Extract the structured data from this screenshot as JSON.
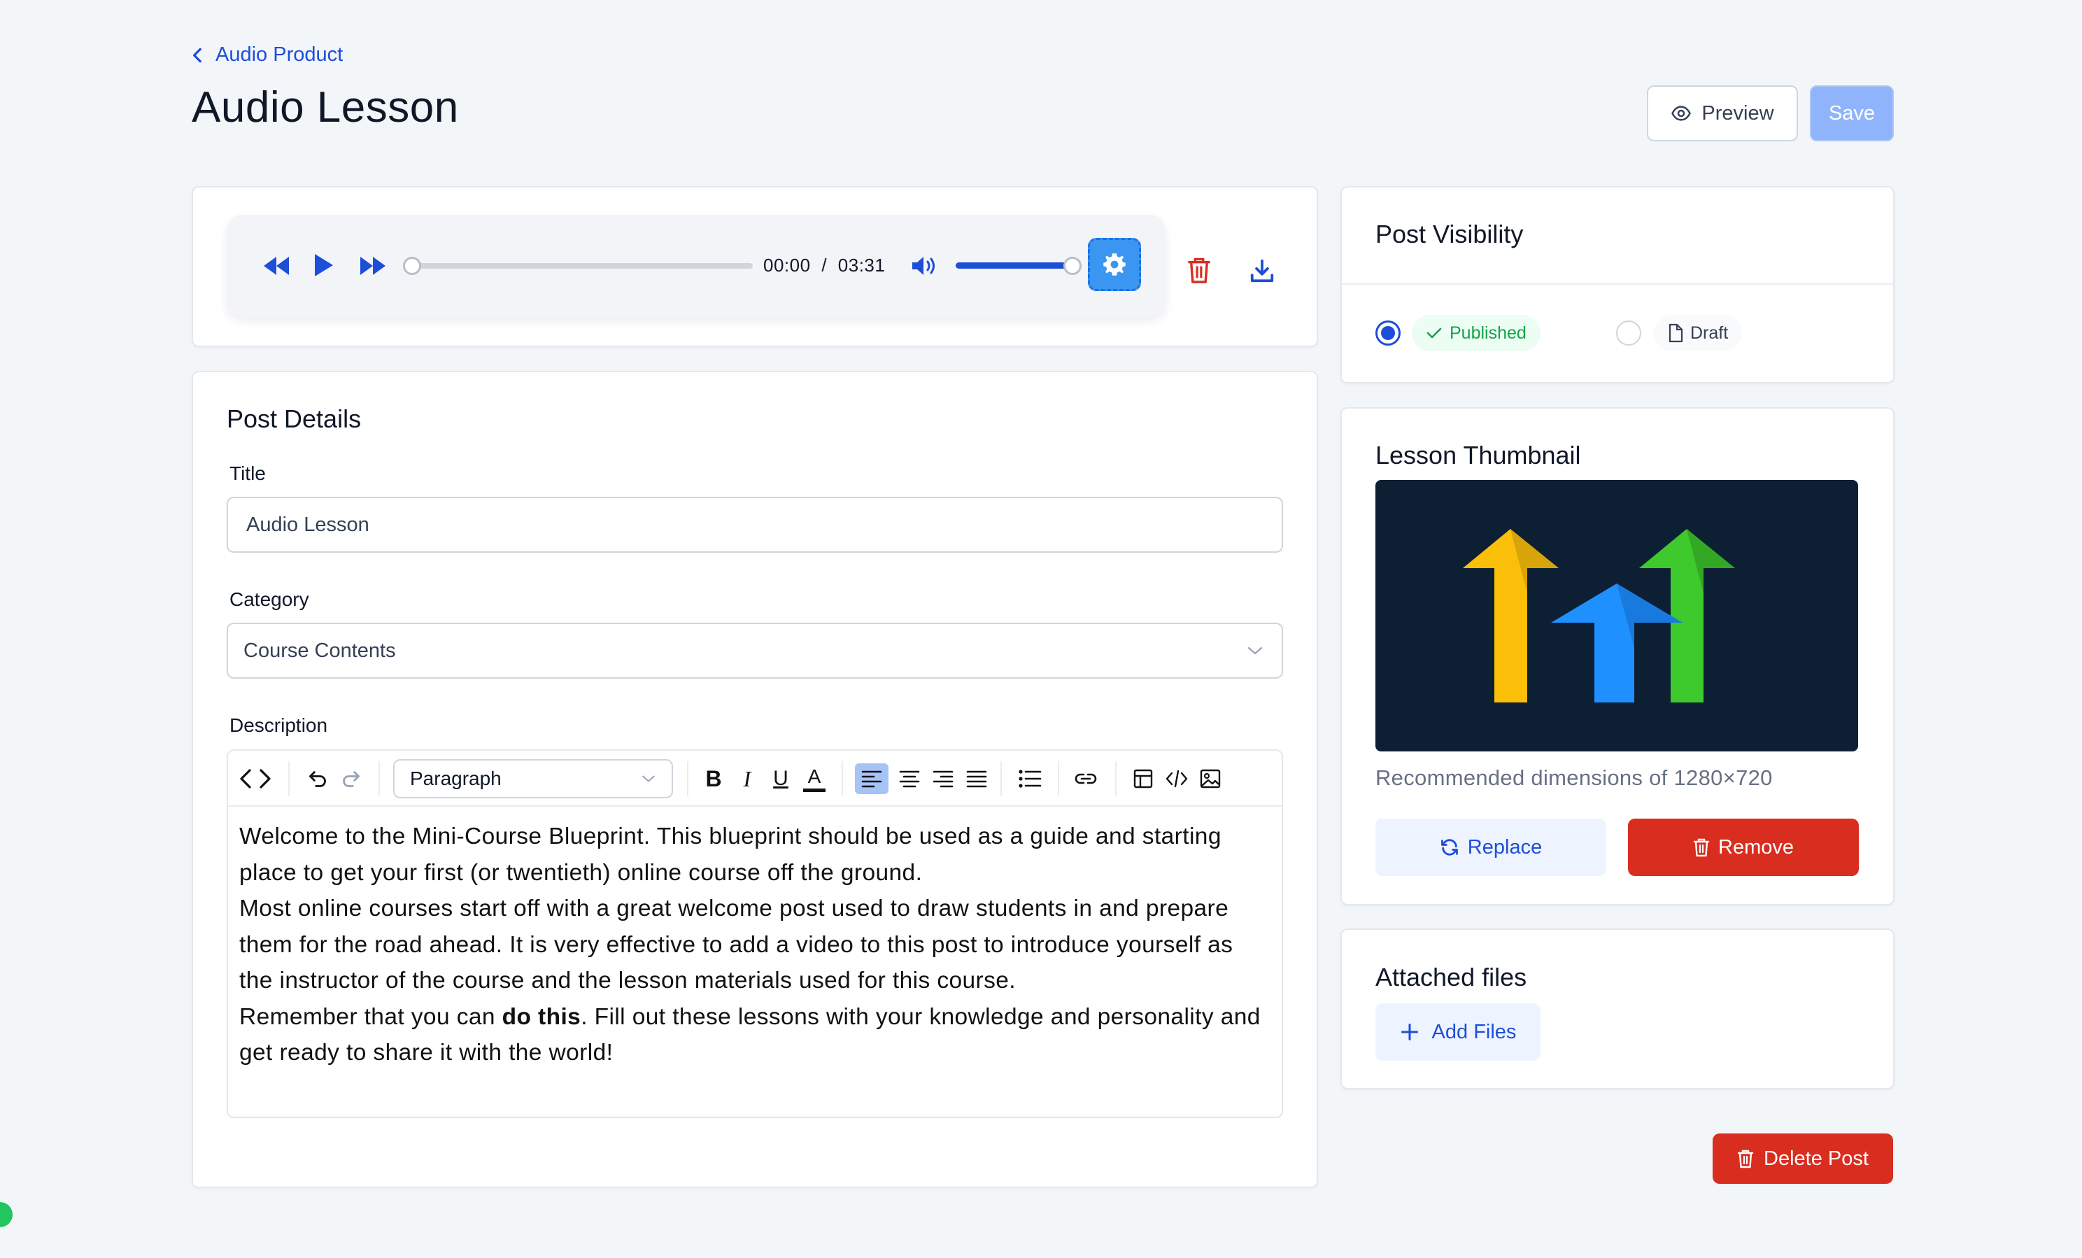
{
  "header": {
    "breadcrumb": "Audio Product",
    "title": "Audio Lesson",
    "preview_label": "Preview",
    "save_label": "Save"
  },
  "audio_player": {
    "current_time": "00:00",
    "separator": "/",
    "duration": "03:31",
    "progress": 0,
    "volume": 1.0
  },
  "post_details": {
    "section_title": "Post Details",
    "title_label": "Title",
    "title_value": "Audio Lesson",
    "category_label": "Category",
    "category_value": "Course Contents",
    "description_label": "Description",
    "editor": {
      "block_format": "Paragraph",
      "active_alignment": "left",
      "paragraphs": {
        "p1": "Welcome to the Mini-Course Blueprint. This blueprint should be used as a guide and starting place to get your first (or twentieth) online course off the ground.",
        "p2": "Most online courses start off with a great welcome post used to draw students in and prepare them for the road ahead. It is very effective to add a video to this post to introduce yourself as the instructor of the course and the lesson materials used for this course.",
        "p3_before": "Remember that you can ",
        "p3_bold": "do this",
        "p3_after": ". Fill out these lessons with your knowledge and personality and get ready to share it with the world!"
      }
    }
  },
  "visibility": {
    "title": "Post Visibility",
    "options": [
      {
        "label": "Published",
        "selected": true
      },
      {
        "label": "Draft",
        "selected": false
      }
    ]
  },
  "thumbnail": {
    "title": "Lesson Thumbnail",
    "hint": "Recommended dimensions of 1280×720",
    "replace_label": "Replace",
    "remove_label": "Remove"
  },
  "attachments": {
    "title": "Attached files",
    "add_label": "Add Files"
  },
  "delete_label": "Delete Post",
  "colors": {
    "accent": "#1d4ed8",
    "danger": "#d92d20",
    "success": "#16a34a",
    "page_bg": "#f3f6f9"
  }
}
